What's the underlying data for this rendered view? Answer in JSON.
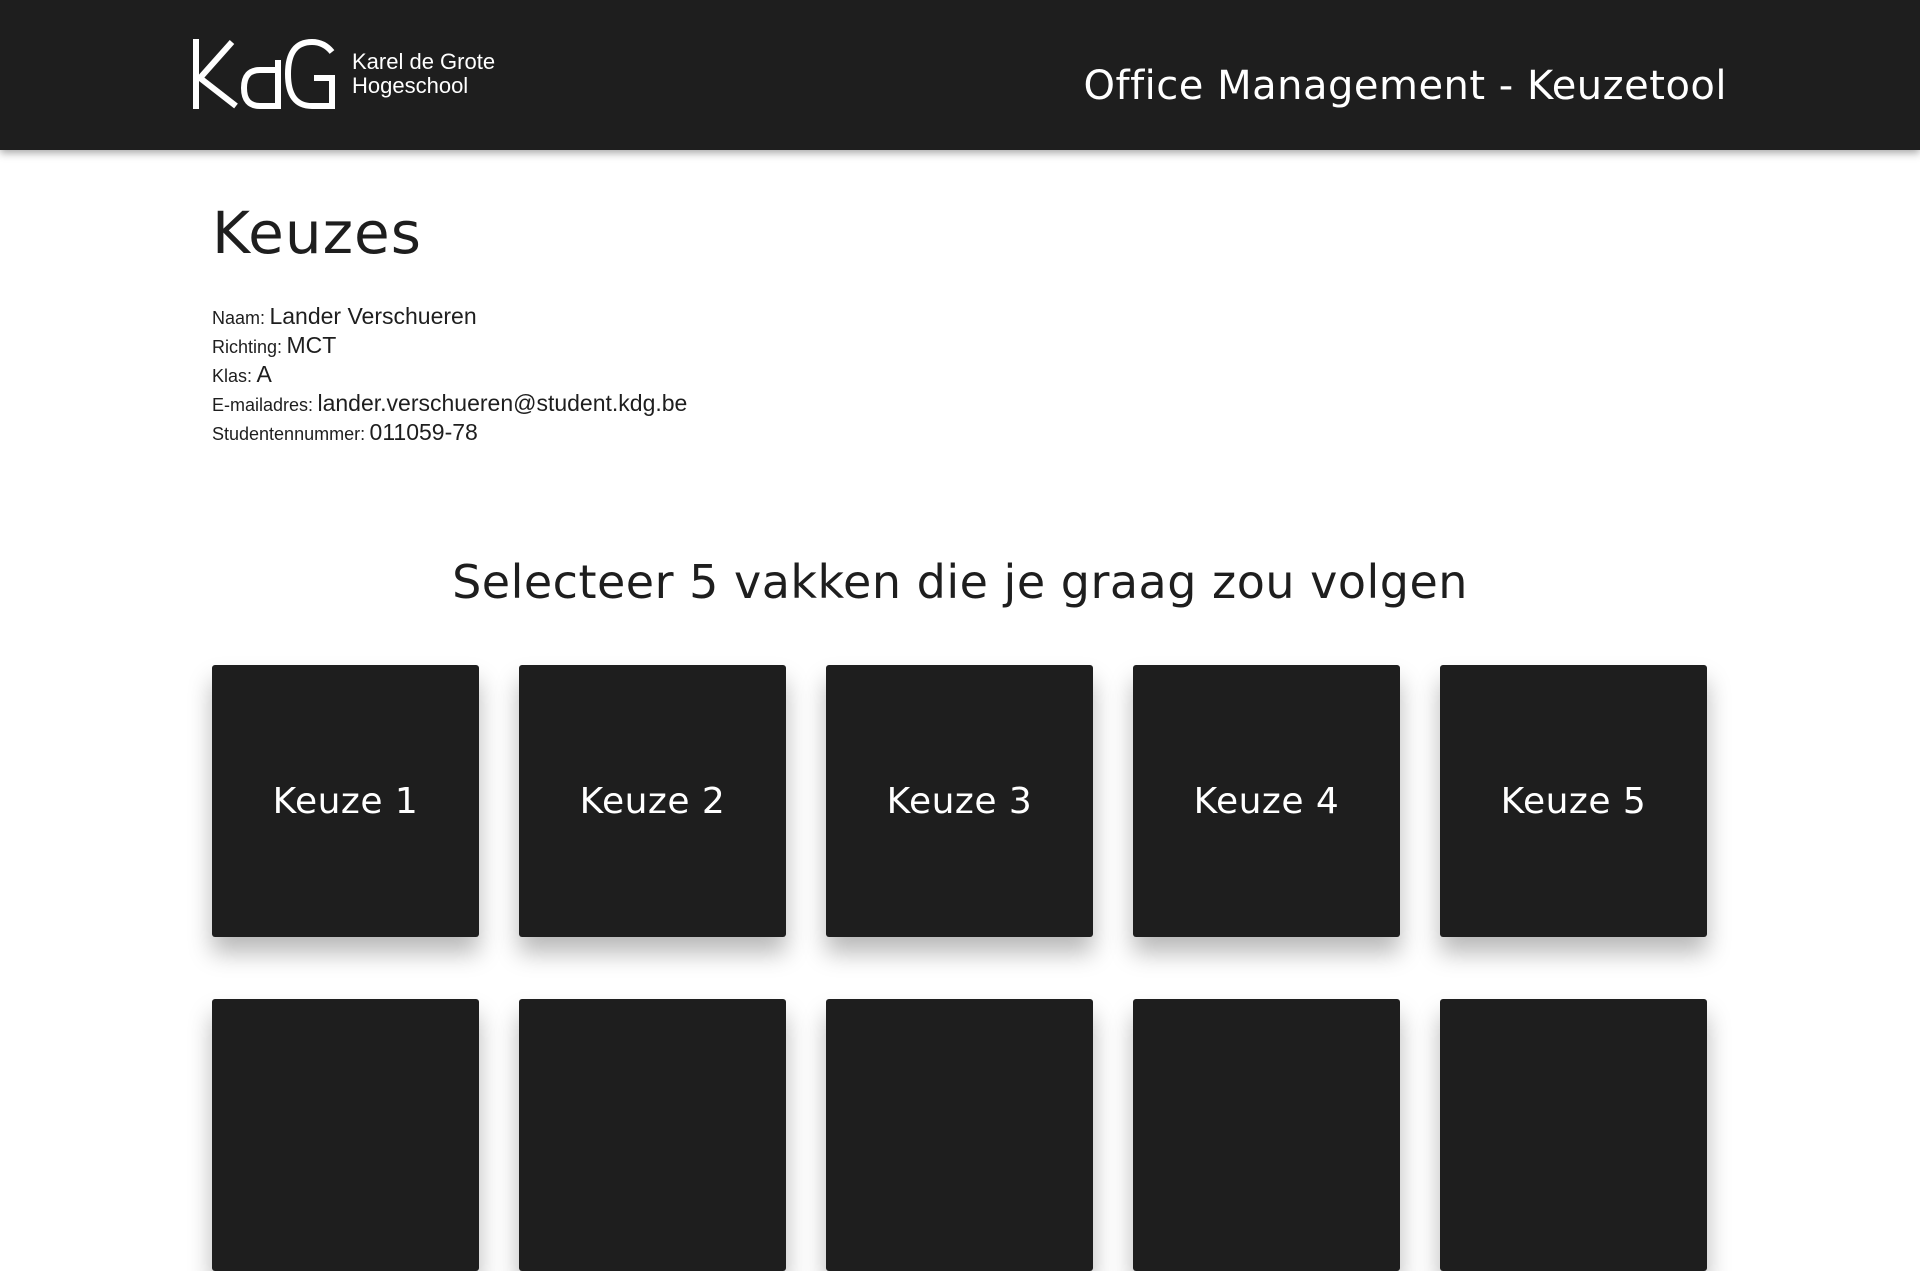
{
  "header": {
    "logo": {
      "mark": "KdG",
      "line1": "Karel de Grote",
      "line2": "Hogeschool"
    },
    "app_title": "Office Management - Keuzetool"
  },
  "page": {
    "title": "Keuzes"
  },
  "student": {
    "fields": [
      {
        "label": "Naam:",
        "value": "Lander Verschueren"
      },
      {
        "label": "Richting:",
        "value": "MCT"
      },
      {
        "label": "Klas:",
        "value": "A"
      },
      {
        "label": "E-mailadres:",
        "value": "lander.verschueren@student.kdg.be"
      },
      {
        "label": "Studentennummer:",
        "value": "011059-78"
      }
    ]
  },
  "selection": {
    "title": "Selecteer 5 vakken die je graag zou volgen",
    "tiles": [
      {
        "label": "Keuze 1"
      },
      {
        "label": "Keuze 2"
      },
      {
        "label": "Keuze 3"
      },
      {
        "label": "Keuze 4"
      },
      {
        "label": "Keuze 5"
      },
      {
        "label": ""
      },
      {
        "label": ""
      },
      {
        "label": ""
      },
      {
        "label": ""
      },
      {
        "label": ""
      }
    ]
  },
  "colors": {
    "header_bg": "#1e1e1e",
    "tile_bg": "#1e1e1e",
    "text": "#1e1e1e",
    "on_dark_text": "#ffffff"
  }
}
